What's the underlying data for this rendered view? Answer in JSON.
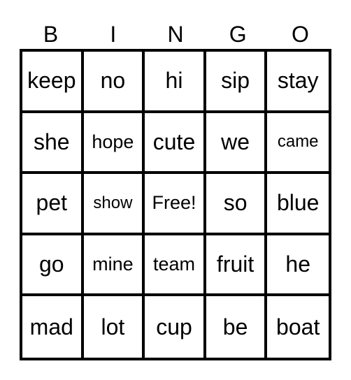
{
  "header": [
    "B",
    "I",
    "N",
    "G",
    "O"
  ],
  "cells": [
    [
      "keep",
      "no",
      "hi",
      "sip",
      "stay"
    ],
    [
      "she",
      "hope",
      "cute",
      "we",
      "came"
    ],
    [
      "pet",
      "show",
      "Free!",
      "so",
      "blue"
    ],
    [
      "go",
      "mine",
      "team",
      "fruit",
      "he"
    ],
    [
      "mad",
      "lot",
      "cup",
      "be",
      "boat"
    ]
  ]
}
